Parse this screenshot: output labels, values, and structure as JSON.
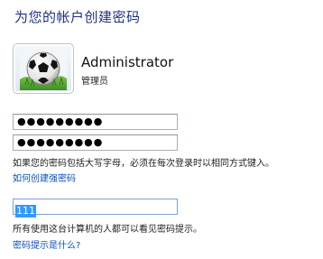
{
  "title": "为您的帐户创建密码",
  "user": {
    "name": "Administrator",
    "role": "管理员",
    "avatar_icon": "soccer-ball-icon"
  },
  "fields": {
    "password": "●●●●●●●●●",
    "confirm_password": "●●●●●●●●●",
    "hint": "111"
  },
  "text": {
    "caps_note": "如果您的密码包括大写字母，必须在每次登录时以相同方式键入。",
    "strong_link": "如何创建强密码",
    "hint_note": "所有使用这台计算机的人都可以看见密码提示。",
    "hint_link": "密码提示是什么?"
  },
  "colors": {
    "title": "#1e3287",
    "link": "#0c4fb8",
    "selection": "#3399ff"
  }
}
